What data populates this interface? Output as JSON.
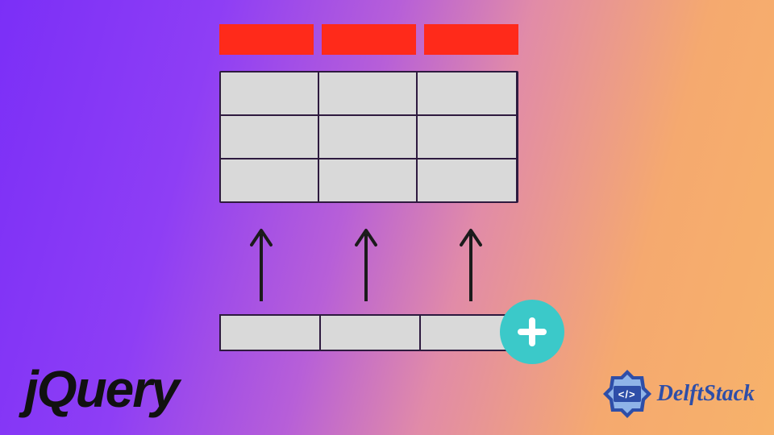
{
  "diagram": {
    "table": {
      "header_cells": 3,
      "body_rows": 3,
      "body_cols": 3
    },
    "arrows_count": 3,
    "new_row_cells": 3
  },
  "icons": {
    "plus": "plus",
    "arrow_up": "arrow-up"
  },
  "colors": {
    "header": "#ff2a1a",
    "cell": "#d9d9d9",
    "outline": "#2e1a3f",
    "plus_badge": "#3bc9c9",
    "brand_blue": "#2e4ea8"
  },
  "brands": {
    "jquery": "jQuery",
    "delftstack": {
      "name": "DelftStack",
      "code_glyph": "</>"
    }
  }
}
